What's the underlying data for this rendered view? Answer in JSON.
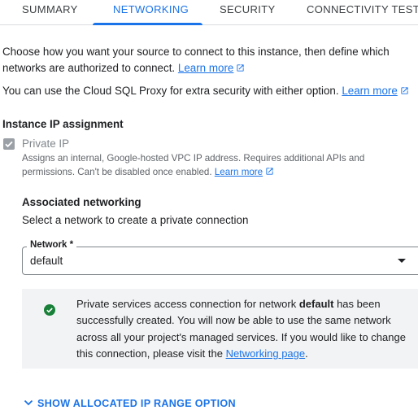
{
  "tabs": [
    {
      "label": "SUMMARY",
      "active": false
    },
    {
      "label": "NETWORKING",
      "active": true
    },
    {
      "label": "SECURITY",
      "active": false
    },
    {
      "label": "CONNECTIVITY TESTS",
      "active": false
    }
  ],
  "intro": {
    "text": "Choose how you want your source to connect to this instance, then define which networks are authorized to connect.",
    "link": "Learn more"
  },
  "proxy": {
    "text": "You can use the Cloud SQL Proxy for extra security with either option.",
    "link": "Learn more"
  },
  "ip_assignment": {
    "title": "Instance IP assignment",
    "private_ip": {
      "label": "Private IP",
      "checked": true,
      "disabled": true,
      "help": "Assigns an internal, Google-hosted VPC IP address. Requires additional APIs and permissions. Can't be disabled once enabled.",
      "help_link": "Learn more"
    }
  },
  "associated_networking": {
    "title": "Associated networking",
    "subtitle": "Select a network to create a private connection",
    "network_field": {
      "label": "Network *",
      "value": "default"
    }
  },
  "notice": {
    "text_before": "Private services access connection for network ",
    "network": "default",
    "text_after": " has been successfully created. You will now be able to use the same network across all your project's managed services. If you would like to change this connection, please visit the ",
    "link": "Networking page",
    "text_end": "."
  },
  "show_range": {
    "label": "SHOW ALLOCATED IP RANGE OPTION"
  },
  "colors": {
    "accent": "#1a73e8",
    "success": "#188038",
    "notice_bg": "#f1f3f4",
    "checkbox_disabled": "#9aa0a6"
  },
  "icons": {
    "external": "open-in-new-icon",
    "check": "check-circle-icon",
    "chevron": "chevron-down-icon",
    "dropdown": "arrow-drop-down-icon"
  }
}
